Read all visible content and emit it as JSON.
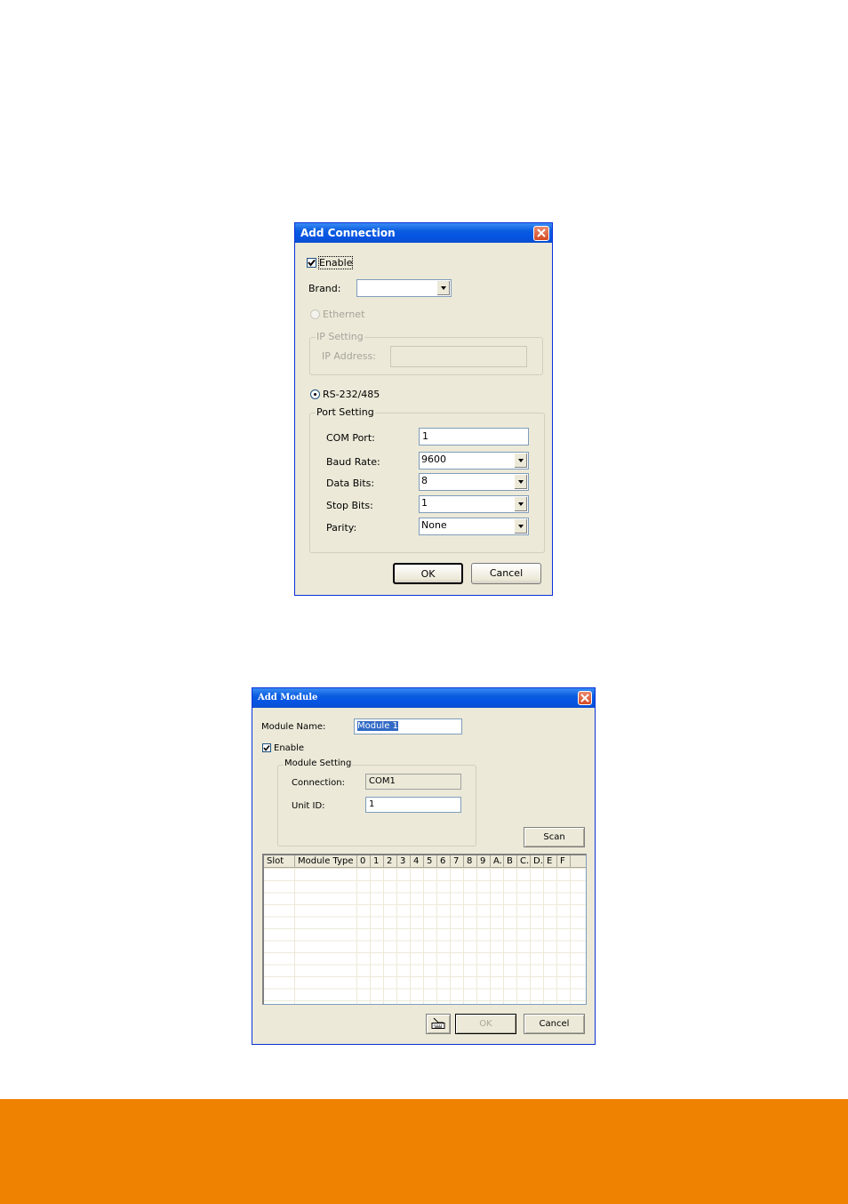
{
  "add_connection": {
    "title": "Add Connection",
    "enable_label": "Enable",
    "enable_checked": true,
    "brand_label": "Brand:",
    "brand_value": "",
    "ethernet_label": "Ethernet",
    "ip_setting_title": "IP Setting",
    "ip_address_label": "IP Address:",
    "ip_address_value": "",
    "rs232_label": "RS-232/485",
    "rs232_selected": true,
    "port_setting_title": "Port Setting",
    "fields": [
      {
        "label": "COM Port:",
        "value": "1",
        "type": "input"
      },
      {
        "label": "Baud Rate:",
        "value": "9600",
        "type": "combo"
      },
      {
        "label": "Data Bits:",
        "value": "8",
        "type": "combo"
      },
      {
        "label": "Stop Bits:",
        "value": "1",
        "type": "combo"
      },
      {
        "label": "Parity:",
        "value": "None",
        "type": "combo"
      }
    ],
    "ok_label": "OK",
    "cancel_label": "Cancel"
  },
  "add_module": {
    "title": "Add Module",
    "module_name_label": "Module Name:",
    "module_name_value": "Module 1",
    "enable_label": "Enable",
    "enable_checked": true,
    "module_setting_title": "Module Setting",
    "connection_label": "Connection:",
    "connection_value": "COM1",
    "unit_id_label": "Unit ID:",
    "unit_id_value": "1",
    "scan_label": "Scan",
    "table_columns": [
      "Slot",
      "Module Type",
      "0",
      "1",
      "2",
      "3",
      "4",
      "5",
      "6",
      "7",
      "8",
      "9",
      "A.",
      "B",
      "C.",
      "D.",
      "E",
      "F"
    ],
    "table_rows": [],
    "ok_label": "OK",
    "cancel_label": "Cancel",
    "keyboard_button_icon": "keyboard-icon"
  },
  "footer": {
    "band_color": "#ef8200"
  }
}
